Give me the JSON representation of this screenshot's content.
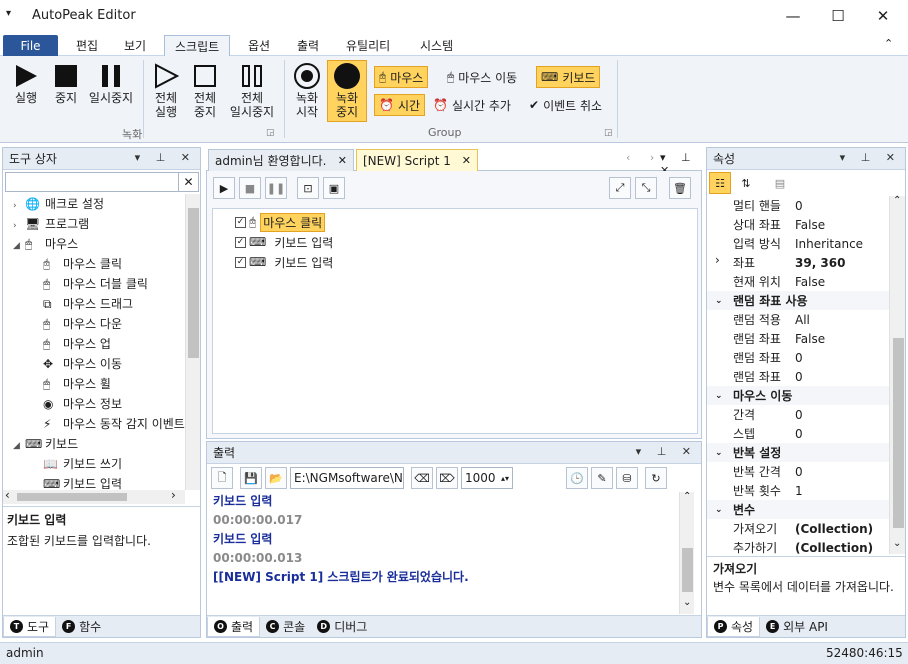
{
  "app": {
    "title": "AutoPeak Editor"
  },
  "ribbon_tabs": [
    "File",
    "편집",
    "보기",
    "스크립트",
    "옵션",
    "출력",
    "유틸리티",
    "시스템"
  ],
  "ribbon": {
    "run": "실행",
    "stop": "중지",
    "pause": "일시중지",
    "run_all_1": "전체",
    "run_all_2": "실행",
    "stop_all_1": "전체",
    "stop_all_2": "중지",
    "pause_all_1": "전체",
    "pause_all_2": "일시중지",
    "record_start_1": "녹화",
    "record_start_2": "시작",
    "record_stop_1": "녹화",
    "record_stop_2": "중지",
    "mouse": "마우스",
    "mouse_move": "마우스 이동",
    "keyboard": "키보드",
    "time": "시간",
    "realtime_add": "실시간 추가",
    "event_cancel": "이벤트 취소",
    "group_record": "녹화",
    "group_group": "Group"
  },
  "toolbox": {
    "title": "도구 상자",
    "items": [
      {
        "label": "매크로 설정",
        "level": 0,
        "expander": "›"
      },
      {
        "label": "프로그램",
        "level": 0,
        "expander": "›"
      },
      {
        "label": "마우스",
        "level": 0,
        "expander": "◢"
      },
      {
        "label": "마우스 클릭",
        "level": 1
      },
      {
        "label": "마우스 더블 클릭",
        "level": 1
      },
      {
        "label": "마우스 드래그",
        "level": 1
      },
      {
        "label": "마우스 다운",
        "level": 1
      },
      {
        "label": "마우스 업",
        "level": 1
      },
      {
        "label": "마우스 이동",
        "level": 1
      },
      {
        "label": "마우스 휠",
        "level": 1
      },
      {
        "label": "마우스 정보",
        "level": 1
      },
      {
        "label": "마우스 동작 감지 이벤트",
        "level": 1
      },
      {
        "label": "키보드",
        "level": 0,
        "expander": "◢"
      },
      {
        "label": "키보드 쓰기",
        "level": 1
      },
      {
        "label": "키보드 입력",
        "level": 1
      }
    ],
    "desc_title": "키보드 입력",
    "desc_text": "조합된 키보드를 입력합니다.",
    "tab_tools": "도구",
    "tab_funcs": "함수"
  },
  "documents": {
    "tab1": "admin님 환영합니다.",
    "tab2": "[NEW] Script 1",
    "script_items": [
      "마우스 클릭",
      "키보드 입력",
      "키보드 입력"
    ]
  },
  "output": {
    "title": "출력",
    "path": "E:\\NGMsoftware\\NG",
    "count": "1000",
    "lines": [
      {
        "text": "키보드 입력",
        "kind": "bold"
      },
      {
        "text": "00:00:00.017",
        "kind": "time"
      },
      {
        "text": "키보드 입력",
        "kind": "bold"
      },
      {
        "text": "00:00:00.013",
        "kind": "time"
      },
      {
        "text": "[[NEW] Script 1] 스크립트가 완료되었습니다.",
        "kind": "bold"
      }
    ],
    "tab_output": "출력",
    "tab_console": "콘솔",
    "tab_debug": "디버그"
  },
  "properties": {
    "title": "속성",
    "rows": [
      {
        "k": "멀티 핸들",
        "v": "0"
      },
      {
        "k": "상대 좌표",
        "v": "False"
      },
      {
        "k": "입력 방식",
        "v": "Inheritance"
      },
      {
        "k": "좌표",
        "v": "39, 360",
        "bold": true,
        "expander": "›"
      },
      {
        "k": "현재 위치",
        "v": "False"
      },
      {
        "cat": "랜덤 좌표 사용"
      },
      {
        "k": "랜덤 적용",
        "v": "All"
      },
      {
        "k": "랜덤 좌표",
        "v": "False"
      },
      {
        "k": "랜덤 좌표",
        "v": "0"
      },
      {
        "k": "랜덤 좌표",
        "v": "0"
      },
      {
        "cat": "마우스 이동"
      },
      {
        "k": "간격",
        "v": "0"
      },
      {
        "k": "스텝",
        "v": "0"
      },
      {
        "cat": "반복 설정"
      },
      {
        "k": "반복 간격",
        "v": "0"
      },
      {
        "k": "반복 횟수",
        "v": "1"
      },
      {
        "cat": "변수"
      },
      {
        "k": "가져오기",
        "v": "(Collection)",
        "bold": true
      },
      {
        "k": "추가하기",
        "v": "(Collection)",
        "bold": true
      }
    ],
    "desc_title": "가져오기",
    "desc_text": "변수 목록에서 데이터를 가져옵니다.",
    "tab_props": "속성",
    "tab_api": "외부 API"
  },
  "status": {
    "user": "admin",
    "clock": "52480:46:15"
  },
  "colors": {
    "accent": "#2b579a",
    "highlight": "#ffd35e",
    "output_text": "#1a2e9a"
  }
}
